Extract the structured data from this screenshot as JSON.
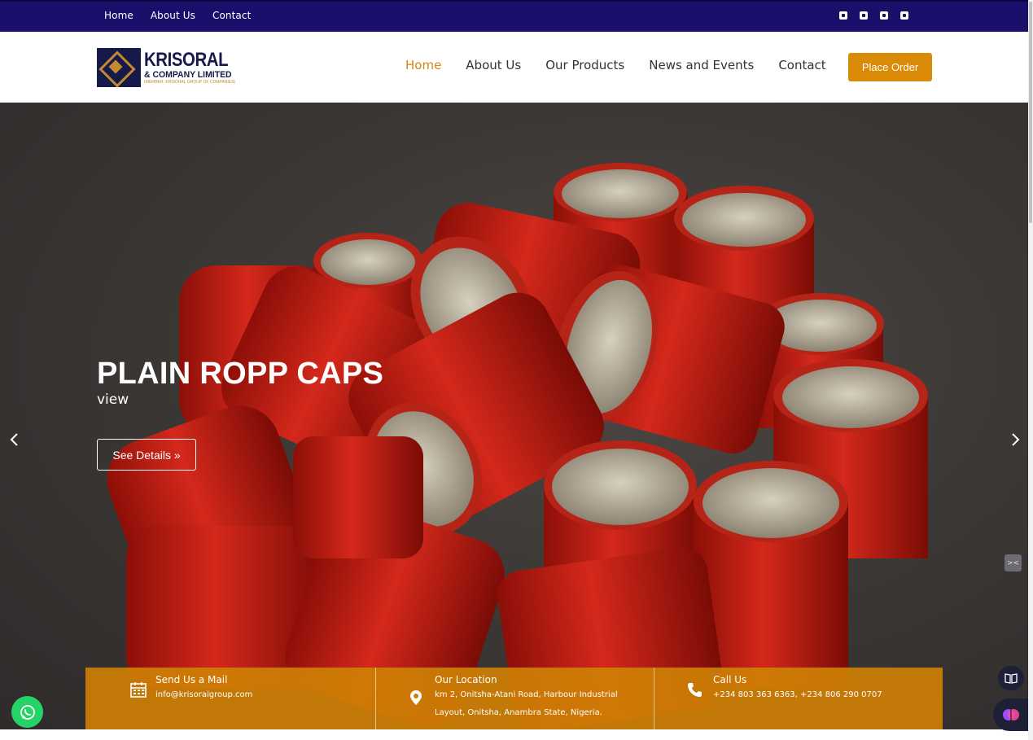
{
  "topbar": {
    "links": [
      "Home",
      "About Us",
      "Contact"
    ],
    "social_icons": [
      "facebook-icon",
      "twitter-icon",
      "linkedin-icon",
      "instagram-icon"
    ],
    "background": "#1a0f6b"
  },
  "header": {
    "logo": {
      "line1": "KRISORAL",
      "line2": "& COMPANY LIMITED",
      "line3": "(MEMBER, KRISORAL GROUP OF COMPANIES)"
    },
    "nav": [
      {
        "label": "Home",
        "active": true
      },
      {
        "label": "About Us",
        "active": false
      },
      {
        "label": "Our Products",
        "active": false
      },
      {
        "label": "News and Events",
        "active": false
      },
      {
        "label": "Contact",
        "active": false
      }
    ],
    "cta_label": "Place Order",
    "accent": "#d98a06"
  },
  "hero": {
    "title": "PLAIN ROPP CAPS",
    "subtitle": "view",
    "button_label": "See Details »",
    "prev_icon": "chevron-left-icon",
    "next_icon": "chevron-right-icon"
  },
  "info": {
    "mail": {
      "title": "Send Us a Mail",
      "text": "info@krisoralgroup.com",
      "icon": "calendar-icon"
    },
    "location": {
      "title": "Our Location",
      "line1": "km 2, Onitsha-Atani Road, Harbour Industrial",
      "line2": "Layout, Onitsha, Anambra State, Nigeria.",
      "icon": "map-pin-icon"
    },
    "call": {
      "title": "Call Us",
      "text": "+234 803 363 6363, +234 806 290 0707",
      "icon": "phone-icon"
    },
    "background": "#ce7f04"
  },
  "widgets": {
    "whatsapp_icon": "whatsapp-icon",
    "reader_icon": "book-icon",
    "ai_icon": "brain-icon"
  }
}
